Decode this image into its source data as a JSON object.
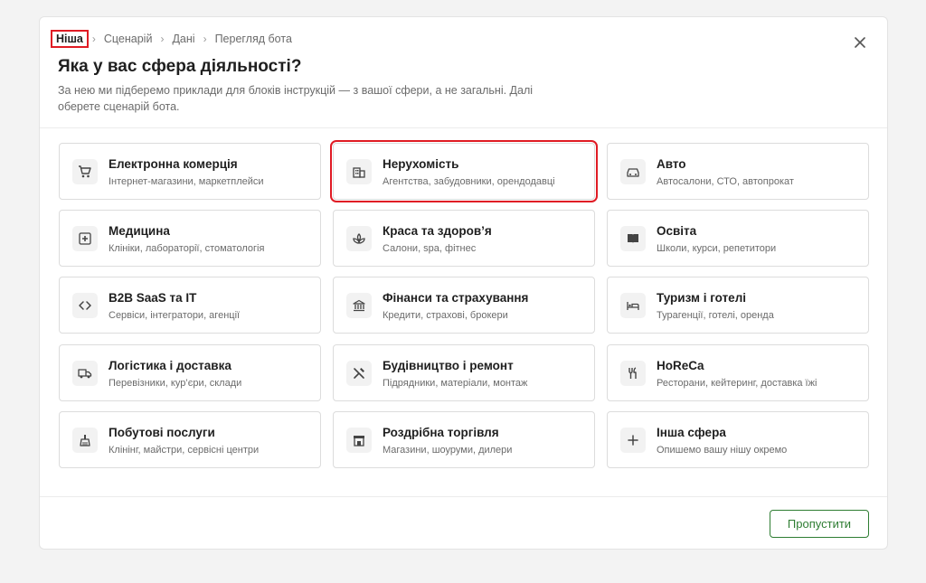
{
  "breadcrumb": [
    "Ніша",
    "Сценарій",
    "Дані",
    "Перегляд бота"
  ],
  "breadcrumb_separator": "›",
  "header": {
    "title": "Яка у вас сфера діяльності?",
    "subtitle": "За нею ми підберемо приклади для блоків інструкцій — з вашої сфери, а не загальні. Далі оберете сценарій бота."
  },
  "close_icon": "close-icon",
  "cards": [
    {
      "name": "Електронна комерція",
      "desc": "Інтернет-магазини, маркетплейси",
      "icon": "cart-icon"
    },
    {
      "name": "Нерухомість",
      "desc": "Агентства, забудовники, орендодавці",
      "icon": "building-icon"
    },
    {
      "name": "Авто",
      "desc": "Автосалони, СТО, автопрокат",
      "icon": "car-icon"
    },
    {
      "name": "Медицина",
      "desc": "Клініки, лабораторії, стоматологія",
      "icon": "medical-cross-icon"
    },
    {
      "name": "Краса та здоров’я",
      "desc": "Салони, spa, фітнес",
      "icon": "spa-icon"
    },
    {
      "name": "Освіта",
      "desc": "Школи, курси, репетитори",
      "icon": "book-icon"
    },
    {
      "name": "B2B SaaS та IT",
      "desc": "Сервіси, інтегратори, агенції",
      "icon": "code-icon"
    },
    {
      "name": "Фінанси та страхування",
      "desc": "Кредити, страхові, брокери",
      "icon": "bank-icon"
    },
    {
      "name": "Туризм і готелі",
      "desc": "Турагенції, готелі, оренда",
      "icon": "bed-icon"
    },
    {
      "name": "Логістика і доставка",
      "desc": "Перевізники, кур’єри, склади",
      "icon": "truck-icon"
    },
    {
      "name": "Будівництво і ремонт",
      "desc": "Підрядники, матеріали, монтаж",
      "icon": "tools-icon"
    },
    {
      "name": "HoReCa",
      "desc": "Ресторани, кейтеринг, доставка їжі",
      "icon": "cutlery-icon"
    },
    {
      "name": "Побутові послуги",
      "desc": "Клінінг, майстри, сервісні центри",
      "icon": "broom-icon"
    },
    {
      "name": "Роздрібна торгівля",
      "desc": "Магазини, шоуруми, дилери",
      "icon": "store-icon"
    },
    {
      "name": "Інша сфера",
      "desc": "Опишемо вашу нішу окремо",
      "icon": "plus-icon"
    }
  ],
  "footer": {
    "skip_label": "Пропустити"
  },
  "colors": {
    "accent": "#2e7d32",
    "highlight": "#e01b24",
    "text": "#1f1f1f",
    "muted": "#6b6b6b"
  }
}
